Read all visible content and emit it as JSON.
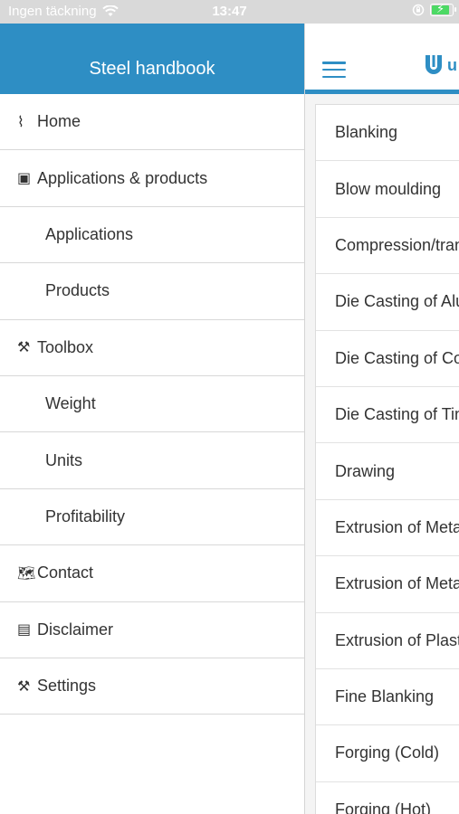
{
  "status_bar": {
    "carrier": "Ingen täckning",
    "time": "13:47"
  },
  "drawer": {
    "title": "Steel handbook",
    "items": [
      {
        "label": "Home",
        "icon": "pulse-icon",
        "sub": false
      },
      {
        "label": "Applications & products",
        "icon": "cube-icon",
        "sub": false
      },
      {
        "label": "Applications",
        "icon": "",
        "sub": true
      },
      {
        "label": "Products",
        "icon": "",
        "sub": true
      },
      {
        "label": "Toolbox",
        "icon": "tools-icon",
        "sub": false
      },
      {
        "label": "Weight",
        "icon": "",
        "sub": true
      },
      {
        "label": "Units",
        "icon": "",
        "sub": true
      },
      {
        "label": "Profitability",
        "icon": "",
        "sub": true
      },
      {
        "label": "Contact",
        "icon": "map-icon",
        "sub": false
      },
      {
        "label": "Disclaimer",
        "icon": "document-icon",
        "sub": false
      },
      {
        "label": "Settings",
        "icon": "tools-icon",
        "sub": false
      }
    ]
  },
  "main": {
    "logo_text": "u",
    "list": [
      "Blanking",
      "Blow moulding",
      "Compression/tran",
      "Die Casting of Alu",
      "Die Casting of Co",
      "Die Casting of Tin",
      "Drawing",
      "Extrusion of Meta",
      "Extrusion of Meta",
      "Extrusion of Plast",
      "Fine Blanking",
      "Forging (Cold)",
      "Forging (Hot)"
    ]
  },
  "colors": {
    "accent": "#2e8ec4",
    "status_bar": "#d9d9d9",
    "battery": "#4cd964"
  }
}
